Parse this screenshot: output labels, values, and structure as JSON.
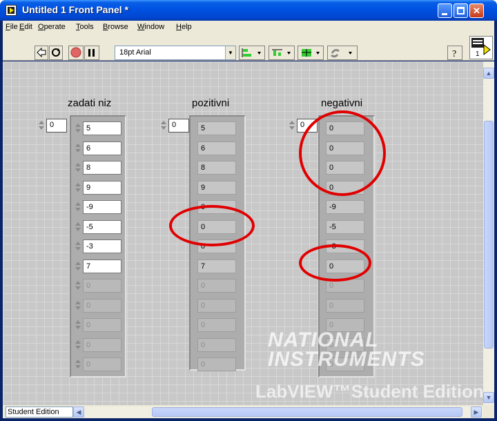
{
  "window": {
    "title": "Untitled 1 Front Panel *"
  },
  "menu": [
    {
      "label": "File",
      "key": "F"
    },
    {
      "label": "Edit",
      "key": "E"
    },
    {
      "label": "Operate",
      "key": "O"
    },
    {
      "label": "Tools",
      "key": "T"
    },
    {
      "label": "Browse",
      "key": "B"
    },
    {
      "label": "Window",
      "key": "W"
    },
    {
      "label": "Help",
      "key": "H"
    }
  ],
  "toolbar": {
    "font": "18pt Arial"
  },
  "arrays": {
    "input": {
      "label": "zadati niz",
      "index": "0",
      "values": [
        "5",
        "6",
        "8",
        "9",
        "-9",
        "-5",
        "-3",
        "7"
      ],
      "empty": [
        "0",
        "0",
        "0",
        "0",
        "0"
      ]
    },
    "positive": {
      "label": "pozitivni",
      "index": "0",
      "values": [
        "5",
        "6",
        "8",
        "9",
        "0",
        "0",
        "0",
        "7"
      ],
      "empty": [
        "0",
        "0",
        "0",
        "0",
        "0"
      ]
    },
    "negative": {
      "label": "negativni",
      "index": "0",
      "values": [
        "0",
        "0",
        "0",
        "0",
        "-9",
        "-5",
        "-3",
        "0"
      ],
      "empty": [
        "0",
        "0",
        "0",
        "0",
        "0"
      ]
    }
  },
  "watermark": {
    "line1": "NATIONAL",
    "line2": "INSTRUMENTS",
    "line3": "LabVIEW™Student Edition"
  },
  "status": {
    "label": "Student Edition"
  },
  "colors": {
    "titlebar": "#0054e3",
    "annotation": "#e00000",
    "panel": "#c8c8c8"
  }
}
